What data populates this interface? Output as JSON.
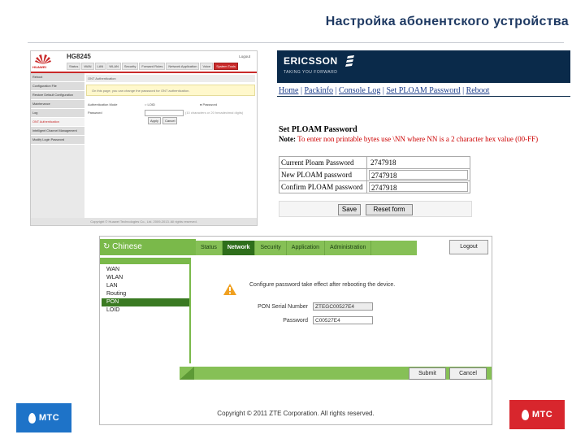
{
  "slide": {
    "title": "Настройка абонентского устройства"
  },
  "huawei": {
    "model": "HG8245",
    "brand": "HUAWEI",
    "logout": "Logout",
    "tabs": [
      "Status",
      "WAN",
      "LAN",
      "WLAN",
      "Security",
      "Forward Rules",
      "Network Application",
      "Voice",
      "System Tools"
    ],
    "active_tab": "System Tools",
    "sidebar": [
      "Reboot",
      "Configuration File",
      "Restore Default Configuration",
      "Maintenance",
      "Log",
      "ONT Authentication",
      "Intelligent Channel Management",
      "Modify Login Password"
    ],
    "content_title": "ONT Authentication",
    "note": "On this page, you can change the password for ONT authentication.",
    "mode_label": "Authentication Mode",
    "mode_options": [
      "LOID",
      "Password"
    ],
    "password_label": "Password",
    "password_hint": "(10 characters or 20 hexadecimal digits)",
    "buttons": [
      "Apply",
      "Cancel"
    ],
    "footer": "Copyright © Huawei Technologies Co., Ltd. 2009-2013. All rights reserved."
  },
  "ericsson": {
    "logo": "ERICSSON",
    "tagline": "TAKING YOU FORWARD",
    "nav": [
      "Home",
      "Packinfo",
      "Console Log",
      "Set PLOAM Password",
      "Reboot"
    ],
    "heading": "Set PLOAM Password",
    "note_label": "Note:",
    "note_text": " To enter non printable bytes use \\NN where NN is a 2 character hex value (00-FF)",
    "rows": [
      {
        "label": "Current Ploam Password",
        "value": "2747918"
      },
      {
        "label": "New PLOAM password",
        "value": "2747918"
      },
      {
        "label": "Confirm PLOAM password",
        "value": "2747918"
      }
    ],
    "buttons": [
      "Save",
      "Reset form"
    ]
  },
  "zte": {
    "logo": "Chinese",
    "tabs": [
      "Status",
      "Network",
      "Security",
      "Application",
      "Administration"
    ],
    "active_tab": "Network",
    "logout": "Logout",
    "sidebar": [
      "WAN",
      "WLAN",
      "LAN",
      "Routing",
      "PON",
      "LOID"
    ],
    "active_side": "PON",
    "message": "Configure password take effect after rebooting the device.",
    "serial_label": "PON Serial Number",
    "serial_value": "ZTEGC00527E4",
    "password_label": "Password",
    "password_value": "C00527E4",
    "buttons": [
      "Submit",
      "Cancel"
    ],
    "footer": "Copyright © 2011 ZTE Corporation. All rights reserved."
  },
  "logos": {
    "left": "МТС",
    "right": "МТС"
  },
  "colors": {
    "title": "#1f3a63",
    "huawei_red": "#c92a2a",
    "ericsson_navy": "#0a2a4a",
    "zte_green": "#7ab94a",
    "mts_blue": "#1e73c8",
    "mts_red": "#d8262d"
  }
}
